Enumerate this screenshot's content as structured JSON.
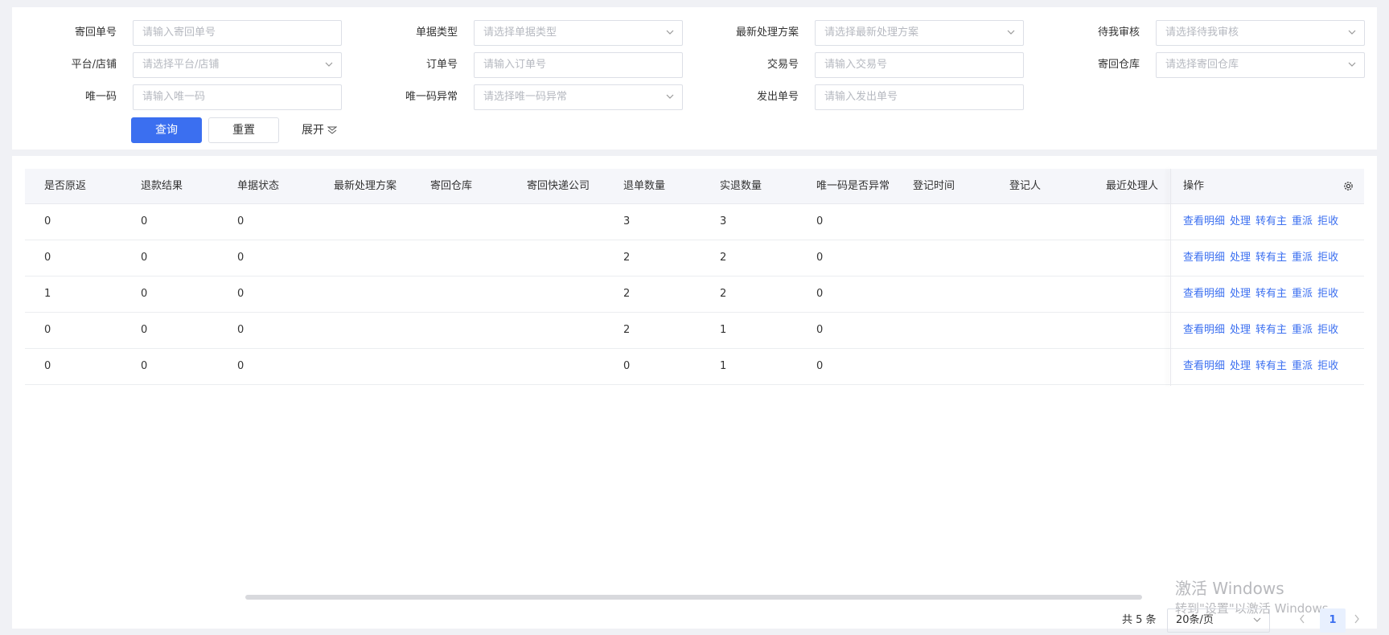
{
  "filters": [
    {
      "label": "寄回单号",
      "placeholder": "请输入寄回单号",
      "type": "input"
    },
    {
      "label": "单据类型",
      "placeholder": "请选择单据类型",
      "type": "select"
    },
    {
      "label": "最新处理方案",
      "placeholder": "请选择最新处理方案",
      "type": "select"
    },
    {
      "label": "待我审核",
      "placeholder": "请选择待我审核",
      "type": "select"
    },
    {
      "label": "平台/店铺",
      "placeholder": "请选择平台/店铺",
      "type": "select"
    },
    {
      "label": "订单号",
      "placeholder": "请输入订单号",
      "type": "input"
    },
    {
      "label": "交易号",
      "placeholder": "请输入交易号",
      "type": "input"
    },
    {
      "label": "寄回仓库",
      "placeholder": "请选择寄回仓库",
      "type": "select"
    },
    {
      "label": "唯一码",
      "placeholder": "请输入唯一码",
      "type": "input"
    },
    {
      "label": "唯一码异常",
      "placeholder": "请选择唯一码异常",
      "type": "select"
    },
    {
      "label": "发出单号",
      "placeholder": "请输入发出单号",
      "type": "input"
    }
  ],
  "buttons": {
    "search": "查询",
    "reset": "重置",
    "expand": "展开"
  },
  "table": {
    "columns": [
      "是否原返",
      "退款结果",
      "单据状态",
      "最新处理方案",
      "寄回仓库",
      "寄回快递公司",
      "退单数量",
      "实退数量",
      "唯一码是否异常",
      "登记时间",
      "登记人",
      "最近处理人"
    ],
    "ops_header": "操作",
    "ops": [
      "查看明细",
      "处理",
      "转有主",
      "重派",
      "拒收"
    ],
    "rows": [
      [
        "0",
        "0",
        "0",
        "",
        "",
        "",
        "3",
        "3",
        "0",
        "",
        "",
        ""
      ],
      [
        "0",
        "0",
        "0",
        "",
        "",
        "",
        "2",
        "2",
        "0",
        "",
        "",
        ""
      ],
      [
        "1",
        "0",
        "0",
        "",
        "",
        "",
        "2",
        "2",
        "0",
        "",
        "",
        ""
      ],
      [
        "0",
        "0",
        "0",
        "",
        "",
        "",
        "2",
        "1",
        "0",
        "",
        "",
        ""
      ],
      [
        "0",
        "0",
        "0",
        "",
        "",
        "",
        "0",
        "1",
        "0",
        "",
        "",
        ""
      ]
    ]
  },
  "pagination": {
    "total": "共 5 条",
    "page_size": "20条/页",
    "current_page": "1"
  },
  "watermark": {
    "line1": "激活 Windows",
    "line2": "转到\"设置\"以激活 Windows。"
  },
  "colors": {
    "accent": "#3b6ff0",
    "header_bg": "#f5f6fa",
    "page_bg": "#f0f1f5"
  }
}
